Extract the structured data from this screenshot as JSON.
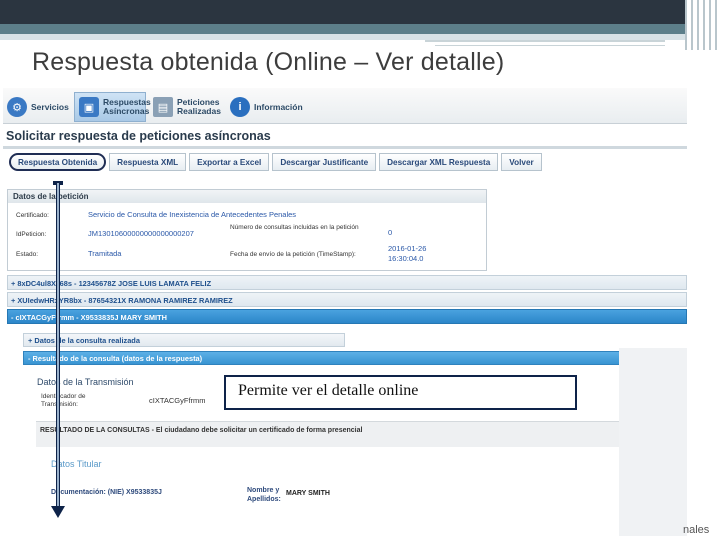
{
  "slide": {
    "title": "Respuesta obtenida (Online – Ver detalle)",
    "footer_fragment": "nales"
  },
  "nav": {
    "items": [
      {
        "label": "Servicios",
        "icon": "gear-icon",
        "color": "#3a79c4"
      },
      {
        "label": "Respuestas\nAsíncronas",
        "icon": "window-icon",
        "color": "#3a79c4"
      },
      {
        "label": "Peticiones\nRealizadas",
        "icon": "document-icon",
        "color": "#8aa0b5"
      },
      {
        "label": "Información",
        "icon": "info-icon",
        "color": "#2a6fbf"
      }
    ]
  },
  "page": {
    "heading": "Solicitar respuesta de peticiones asíncronas"
  },
  "actions": [
    "Respuesta Obtenida",
    "Respuesta XML",
    "Exportar a Excel",
    "Descargar Justificante",
    "Descargar XML Respuesta",
    "Volver"
  ],
  "datos_peticion": {
    "header": "Datos de la petición",
    "certificado_label": "Certificado:",
    "certificado_value": "Servicio de Consulta de Inexistencia de Antecedentes Penales",
    "id_label": "IdPeticion:",
    "id_value": "JM13010600000000000000207",
    "estado_label": "Estado:",
    "estado_value": "Tramitada",
    "num_consultas_label": "Número de consultas incluidas en la petición",
    "num_consultas_value": "0",
    "fecha_label": "Fecha de envío de la petición (TimeStamp):",
    "fecha_value": "2016-01-26\n16:30:04.0"
  },
  "results": [
    "+ 8xDC4ul8Xz68s - 12345678Z JOSE LUIS LAMATA FELIZ",
    "+ XUIedwHRxYR8bx - 87654321X RAMONA RAMIREZ RAMIREZ",
    "- cIXTACGyFfrmm - X9533835J MARY SMITH"
  ],
  "detail": {
    "consulta_realizada": "+ Datos de la consulta realizada",
    "resultado_header": "- Resultado de la consulta (datos de la respuesta)",
    "transmision_title": "Datos de la Transmisión",
    "identificador_label": "Identificador de\nTransmisión:",
    "identificador_value": "cIXTACGyFfrmm",
    "resultado_text": "RESULTADO DE LA CONSULTAS - El ciudadano debe solicitar un certificado de forma presencial",
    "titular_title": "Datos Titular",
    "documentacion_label": "Documentación: (NIE) X9533835J",
    "nombre_label": "Nombre y\nApellidos:",
    "nombre_value": "MARY SMITH"
  },
  "callout": {
    "text": "Permite ver el detalle online"
  },
  "colors": {
    "accent_blue": "#2b86c9",
    "callout_border": "#0e2349",
    "slide_bar": "#2b3540"
  }
}
